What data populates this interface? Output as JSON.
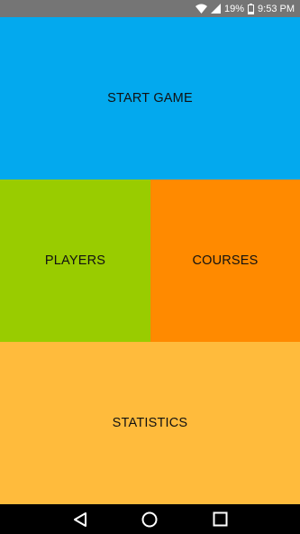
{
  "status_bar": {
    "battery": "19%",
    "time": "9:53 PM"
  },
  "tiles": {
    "start_game": {
      "label": "START GAME",
      "color": "#03A9EE"
    },
    "players": {
      "label": "PLAYERS",
      "color": "#99CC00"
    },
    "courses": {
      "label": "COURSES",
      "color": "#FF8A00"
    },
    "statistics": {
      "label": "STATISTICS",
      "color": "#FFBB3C"
    }
  },
  "nav_bar": {
    "icons": [
      "back-icon",
      "home-icon",
      "recents-icon"
    ]
  }
}
